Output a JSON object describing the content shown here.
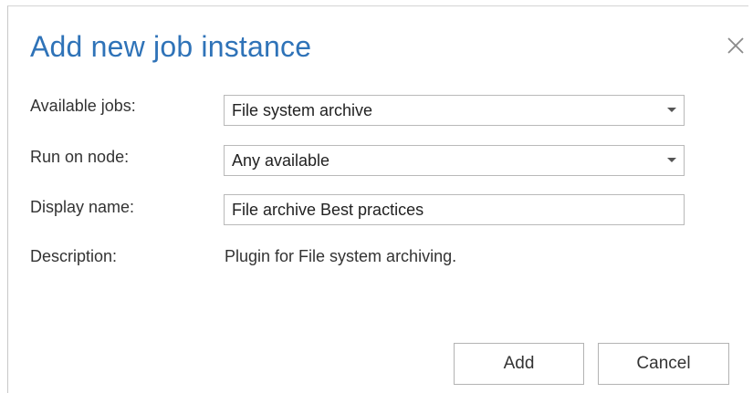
{
  "dialog": {
    "title": "Add new job instance",
    "close_icon": "close-icon",
    "accent_color": "#2f73b8"
  },
  "form": {
    "available_jobs": {
      "label": "Available jobs:",
      "value": "File system archive"
    },
    "run_on_node": {
      "label": "Run on node:",
      "value": "Any available"
    },
    "display_name": {
      "label": "Display name:",
      "value": "File archive Best practices"
    },
    "description": {
      "label": "Description:",
      "value": "Plugin for File system archiving."
    }
  },
  "buttons": {
    "add_label": "Add",
    "cancel_label": "Cancel"
  }
}
